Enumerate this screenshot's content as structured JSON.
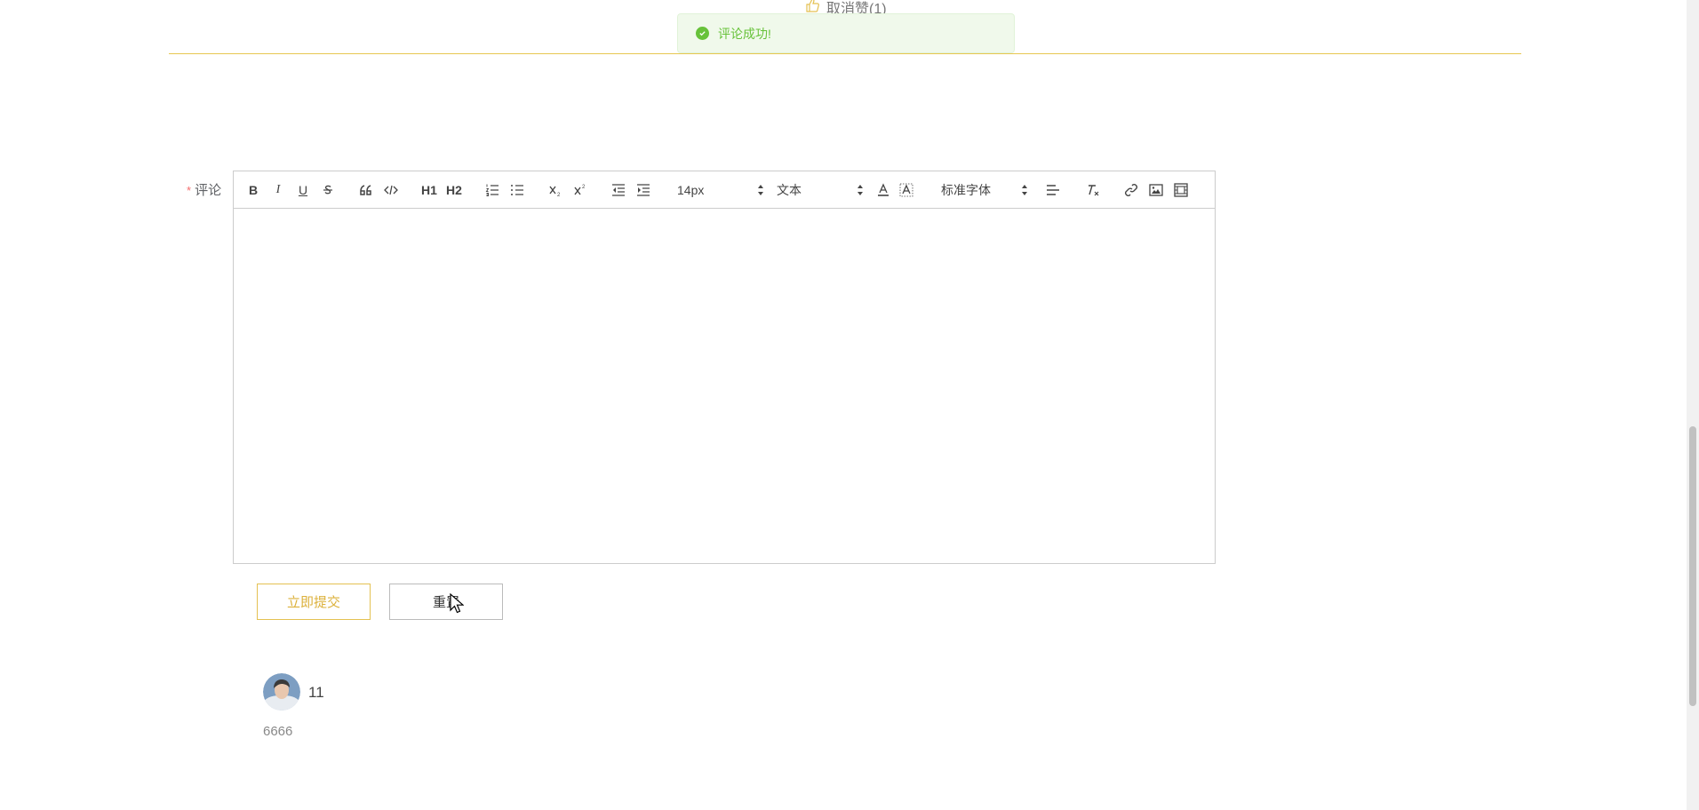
{
  "post": {
    "unlike_label": "取消赞(1)"
  },
  "toast": {
    "message": "评论成功!"
  },
  "form": {
    "comment_label": "评论",
    "required_mark": "*",
    "submit_label": "立即提交",
    "reset_label": "重置"
  },
  "editor": {
    "size_picker": "14px",
    "header_picker": "文本",
    "font_picker": "标准字体",
    "buttons": {
      "bold": "B",
      "italic": "I",
      "underline": "U",
      "header1": "H1",
      "header2": "H2"
    }
  },
  "comments": [
    {
      "user": "11",
      "text": "6666"
    }
  ],
  "colors": {
    "accent": "#dcb13b",
    "success": "#67c23a",
    "required": "#f56c6c"
  }
}
